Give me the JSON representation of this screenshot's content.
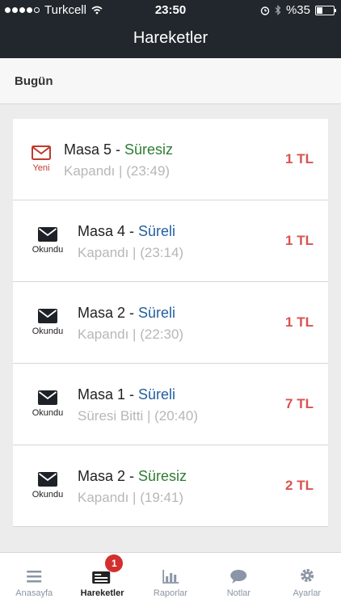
{
  "status_bar": {
    "carrier": "Turkcell",
    "time": "23:50",
    "battery": "%35"
  },
  "header": {
    "title": "Hareketler"
  },
  "section": {
    "title": "Bugün"
  },
  "items": [
    {
      "icon": "mail-outline-icon",
      "status": "Yeni",
      "table": "Masa 5",
      "sep": " - ",
      "type": "Süresiz",
      "detail": "Kapandı | (23:49)",
      "amount": "1 TL"
    },
    {
      "icon": "mail-filled-icon",
      "status": "Okundu",
      "table": "Masa 4",
      "sep": " - ",
      "type": "Süreli",
      "detail": "Kapandı | (23:14)",
      "amount": "1 TL"
    },
    {
      "icon": "mail-filled-icon",
      "status": "Okundu",
      "table": "Masa 2",
      "sep": " - ",
      "type": "Süreli",
      "detail": "Kapandı | (22:30)",
      "amount": "1 TL"
    },
    {
      "icon": "mail-filled-icon",
      "status": "Okundu",
      "table": "Masa 1",
      "sep": " - ",
      "type": "Süreli",
      "detail": "Süresi Bitti | (20:40)",
      "amount": "7 TL"
    },
    {
      "icon": "mail-filled-icon",
      "status": "Okundu",
      "table": "Masa 2",
      "sep": " - ",
      "type": "Süresiz",
      "detail": "Kapandı | (19:41)",
      "amount": "2 TL"
    }
  ],
  "tabs": [
    {
      "label": "Anasayfa",
      "icon": "home-icon"
    },
    {
      "label": "Hareketler",
      "icon": "list-icon",
      "badge": "1"
    },
    {
      "label": "Raporlar",
      "icon": "bar-chart-icon"
    },
    {
      "label": "Notlar",
      "icon": "chat-icon"
    },
    {
      "label": "Ayarlar",
      "icon": "gear-icon"
    }
  ],
  "colors": {
    "topbar": "#22272d",
    "amount": "#d9534f",
    "new": "#c0392b",
    "untimed": "#2e7d32",
    "timed": "#225f9e"
  }
}
